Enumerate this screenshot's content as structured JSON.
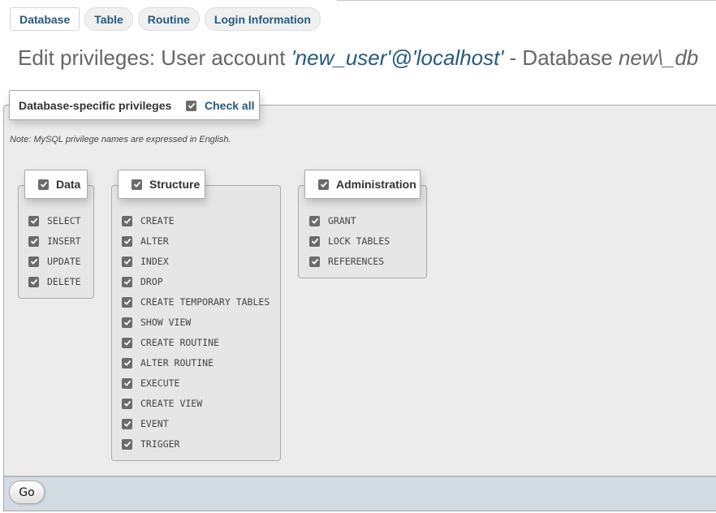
{
  "tabs": [
    {
      "label": "Database",
      "active": true
    },
    {
      "label": "Table",
      "active": false
    },
    {
      "label": "Routine",
      "active": false
    },
    {
      "label": "Login Information",
      "active": false
    }
  ],
  "title": {
    "prefix": "Edit privileges: User account ",
    "account": "'new_user'@'localhost'",
    "middle": " - Database ",
    "database": "new\\_db"
  },
  "fieldset": {
    "legend": "Database-specific privileges",
    "check_all_label": "Check all",
    "check_all_checked": true,
    "note": "Note: MySQL privilege names are expressed in English."
  },
  "groups": {
    "data": {
      "label": "Data",
      "checked": true,
      "items": [
        "SELECT",
        "INSERT",
        "UPDATE",
        "DELETE"
      ]
    },
    "structure": {
      "label": "Structure",
      "checked": true,
      "items": [
        "CREATE",
        "ALTER",
        "INDEX",
        "DROP",
        "CREATE TEMPORARY TABLES",
        "SHOW VIEW",
        "CREATE ROUTINE",
        "ALTER ROUTINE",
        "EXECUTE",
        "CREATE VIEW",
        "EVENT",
        "TRIGGER"
      ]
    },
    "administration": {
      "label": "Administration",
      "checked": true,
      "items": [
        "GRANT",
        "LOCK TABLES",
        "REFERENCES"
      ]
    }
  },
  "footer": {
    "go_label": "Go"
  },
  "colors": {
    "link": "#235a81",
    "fieldset_bg": "#ececec",
    "footer_bg": "#d3dbe3",
    "checkbox": "#6b6b6b"
  }
}
